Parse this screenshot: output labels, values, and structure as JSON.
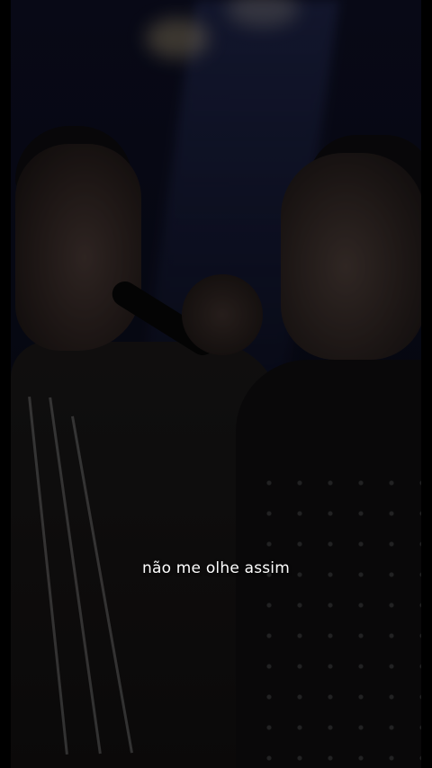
{
  "video": {
    "subtitle": "não me olhe assim"
  }
}
